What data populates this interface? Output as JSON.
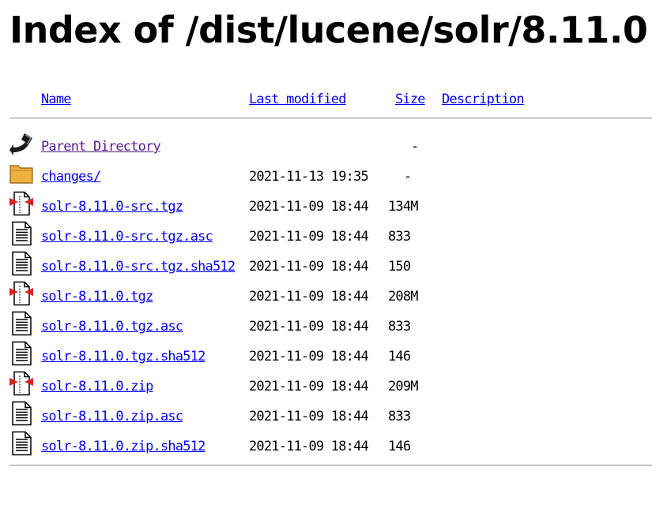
{
  "page": {
    "title": "Index of /dist/lucene/solr/8.11.0"
  },
  "columns": {
    "name": "Name",
    "last_modified": "Last modified",
    "size": "Size",
    "description": "Description"
  },
  "rows": [
    {
      "icon": "back-arrow-icon",
      "name": "Parent Directory",
      "modified": "",
      "size": "-",
      "visited": true
    },
    {
      "icon": "folder-icon",
      "name": "changes/",
      "modified": "2021-11-13 19:35",
      "size": "-"
    },
    {
      "icon": "compressed-file-icon",
      "name": "solr-8.11.0-src.tgz",
      "modified": "2021-11-09 18:44",
      "size": "134M"
    },
    {
      "icon": "text-file-icon",
      "name": "solr-8.11.0-src.tgz.asc",
      "modified": "2021-11-09 18:44",
      "size": "833"
    },
    {
      "icon": "text-file-icon",
      "name": "solr-8.11.0-src.tgz.sha512",
      "modified": "2021-11-09 18:44",
      "size": "150"
    },
    {
      "icon": "compressed-file-icon",
      "name": "solr-8.11.0.tgz",
      "modified": "2021-11-09 18:44",
      "size": "208M"
    },
    {
      "icon": "text-file-icon",
      "name": "solr-8.11.0.tgz.asc",
      "modified": "2021-11-09 18:44",
      "size": "833"
    },
    {
      "icon": "text-file-icon",
      "name": "solr-8.11.0.tgz.sha512",
      "modified": "2021-11-09 18:44",
      "size": "146"
    },
    {
      "icon": "compressed-file-icon",
      "name": "solr-8.11.0.zip",
      "modified": "2021-11-09 18:44",
      "size": "209M"
    },
    {
      "icon": "text-file-icon",
      "name": "solr-8.11.0.zip.asc",
      "modified": "2021-11-09 18:44",
      "size": "833"
    },
    {
      "icon": "text-file-icon",
      "name": "solr-8.11.0.zip.sha512",
      "modified": "2021-11-09 18:44",
      "size": "146"
    }
  ],
  "colors": {
    "link": "#0000ee",
    "visited_link": "#551a8b",
    "folder": "#f0b040",
    "compressed_marker": "#e02020"
  }
}
